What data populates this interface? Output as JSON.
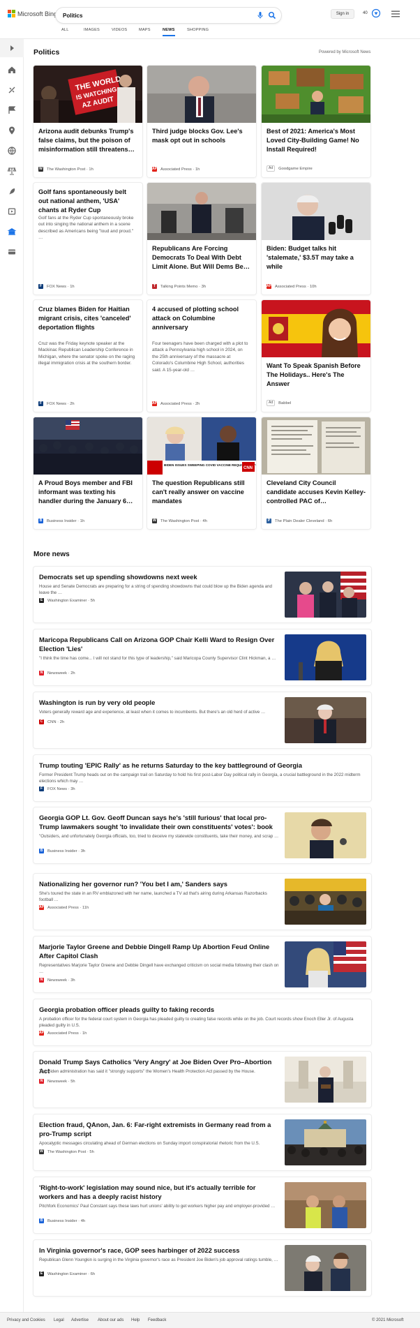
{
  "header": {
    "logo_text": "Microsoft Bing",
    "search_value": "Politics",
    "signin_label": "Sign in",
    "points": "40",
    "tabs": [
      "ALL",
      "IMAGES",
      "VIDEOS",
      "MAPS",
      "NEWS",
      "SHOPPING"
    ],
    "active_tab": "NEWS"
  },
  "rail": {
    "icons": [
      "expand-icon",
      "home-icon",
      "sports-icon",
      "flag-icon",
      "location-icon",
      "globe-icon",
      "scales-icon",
      "rocket-icon",
      "entertainment-icon",
      "bank-icon",
      "card-icon"
    ]
  },
  "section": {
    "title": "Politics",
    "powered": "Powered by Microsoft News"
  },
  "cards": [
    {
      "title": "Arizona audit debunks Trump's false claims, but the poison of misinformation still threatens…",
      "snippet": "",
      "source": "The Washington Post",
      "age": "1h",
      "fav": "#333",
      "fav_letter": "W",
      "ad": false
    },
    {
      "title": "Third judge blocks Gov. Lee's mask opt out in schools",
      "snippet": "",
      "source": "Associated Press",
      "age": "1h",
      "fav": "#e2231a",
      "fav_letter": "AP",
      "ad": false
    },
    {
      "title": "Best of 2021: America's Most Loved City-Building Game! No Install Required!",
      "snippet": "",
      "source": "Goodgame Empire",
      "age": "",
      "fav": "",
      "fav_letter": "",
      "ad": true,
      "ad_label": "Ad"
    },
    {
      "title": "Golf fans spontaneously belt out national anthem, 'USA' chants at Ryder Cup",
      "snippet": "Golf fans at the Ryder Cup spontaneously broke out into singing the national anthem in a scene described as Americans being \"loud and proud.\" …",
      "source": "FOX News",
      "age": "1h",
      "fav": "#0f3d7a",
      "fav_letter": "F",
      "ad": false
    },
    {
      "title": "Republicans Are Forcing Democrats To Deal With Debt Limit Alone. But Will Dems Be…",
      "snippet": "",
      "source": "Talking Points Memo",
      "age": "3h",
      "fav": "#c0282d",
      "fav_letter": "T",
      "ad": false
    },
    {
      "title": "Biden: Budget talks hit 'stalemate,' $3.5T may take a while",
      "snippet": "",
      "source": "Associated Press",
      "age": "10h",
      "fav": "#e2231a",
      "fav_letter": "AP",
      "ad": false
    },
    {
      "title": "Cruz blames Biden for Haitian migrant crisis, cites 'canceled' deportation flights",
      "snippet": "Cruz was the Friday keynote speaker at the Mackinac Republican Leadership Conference in Michigan, where the senator spoke on the raging illegal immigration crisis at the southern border.",
      "source": "FOX News",
      "age": "2h",
      "fav": "#0f3d7a",
      "fav_letter": "F",
      "ad": false
    },
    {
      "title": "4 accused of plotting school attack on Columbine anniversary",
      "snippet": "Four teenagers have been charged with a plot to attack a Pennsylvania high school in 2024, on the 25th anniversary of the massacre at Colorado's Columbine High School, authorities said. A 15-year-old …",
      "source": "Associated Press",
      "age": "2h",
      "fav": "#e2231a",
      "fav_letter": "AP",
      "ad": false
    },
    {
      "title": "Want To Speak Spanish Before The Holidays.. Here's The Answer",
      "snippet": "",
      "source": "Babbel",
      "age": "",
      "fav": "",
      "fav_letter": "",
      "ad": true,
      "ad_label": "Ad"
    },
    {
      "title": "A Proud Boys member and FBI informant was texting his handler during the January 6…",
      "snippet": "",
      "source": "Business Insider",
      "age": "1h",
      "fav": "#1a63d8",
      "fav_letter": "B",
      "ad": false
    },
    {
      "title": "The question Republicans still can't really answer on vaccine mandates",
      "snippet": "",
      "source": "The Washington Post",
      "age": "4h",
      "fav": "#333",
      "fav_letter": "W",
      "ad": false
    },
    {
      "title": "Cleveland City Council candidate accuses Kevin Kelley-controlled PAC of…",
      "snippet": "",
      "source": "The Plain Dealer Cleveland",
      "age": "6h",
      "fav": "#2b5f9e",
      "fav_letter": "P",
      "ad": false
    }
  ],
  "card_art": {
    "cnn_banner": "BIDEN ISSUES SWEEPING COVID VACCINE REQUIREMENTS FOR FEDERAL WORKERS AND CONTRACTORS, LARGE BUSINESSES",
    "cnn_logo": "CNN",
    "sign_text_1": "THE WORLD",
    "sign_text_2": "IS WATCHING",
    "sign_text_3": "AZ AUDIT"
  },
  "more": {
    "title": "More news",
    "rows": [
      {
        "title": "Democrats set up spending showdowns next week",
        "snippet": "House and Senate Democrats are preparing for a string of spending showdowns that could blow up the Biden agenda and leave the …",
        "source": "Washington Examiner",
        "age": "5h",
        "fav": "#222",
        "fav_letter": "E",
        "has_img": true
      },
      {
        "title": "Maricopa Republicans Call on Arizona GOP Chair Kelli Ward to Resign Over Election 'Lies'",
        "snippet": "\"I think the time has come... I will not stand for this type of leadership,\" said Maricopa County Supervisor Clint Hickman, a …",
        "source": "Newsweek",
        "age": "2h",
        "fav": "#e0202a",
        "fav_letter": "N",
        "has_img": true
      },
      {
        "title": "Washington is run by very old people",
        "snippet": "Voters generally reward age and experience, at least when it comes to incumbents. But there's an old herd of active …",
        "source": "CNN",
        "age": "2h",
        "fav": "#cc0000",
        "fav_letter": "C",
        "has_img": true
      },
      {
        "title": "Trump touting 'EPIC Rally' as he returns Saturday to the key battleground of Georgia",
        "snippet": "Former President Trump heads out on the campaign trail on Saturday to hold his first post-Labor Day political rally in Georgia, a crucial battleground in the 2022 midterm elections which may …",
        "source": "FOX News",
        "age": "3h",
        "fav": "#0f3d7a",
        "fav_letter": "F",
        "has_img": false
      },
      {
        "title": "Georgia GOP Lt. Gov. Geoff Duncan says he's 'still furious' that local pro-Trump lawmakers sought 'to invalidate their own constituents' votes': book",
        "snippet": "\"Outsiders, and unfortunately Georgia officials, too, tried to deceive my statewide constituents, take their money, and scrap …",
        "source": "Business Insider",
        "age": "3h",
        "fav": "#1a63d8",
        "fav_letter": "B",
        "has_img": true
      },
      {
        "title": "Nationalizing her governor run? 'You bet I am,' Sanders says",
        "snippet": "She's toured the state in an RV emblazoned with her name, launched a TV ad that's airing during Arkansas Razorbacks football …",
        "source": "Associated Press",
        "age": "11h",
        "fav": "#e2231a",
        "fav_letter": "AP",
        "has_img": true
      },
      {
        "title": "Marjorie Taylor Greene and Debbie Dingell Ramp Up Abortion Feud Online After Capitol Clash",
        "snippet": "Representatives Marjorie Taylor Greene and Debbie Dingell have exchanged criticism on social media following their clash on …",
        "source": "Newsweek",
        "age": "3h",
        "fav": "#e0202a",
        "fav_letter": "N",
        "has_img": true
      },
      {
        "title": "Georgia probation officer pleads guilty to faking records",
        "snippet": "A probation officer for the federal court system in Georgia has pleaded guilty to creating false records while on the job. Court records show Enoch Eller Jr. of Augusta pleaded guilty in U.S.",
        "source": "Associated Press",
        "age": "1h",
        "fav": "#e2231a",
        "fav_letter": "AP",
        "has_img": false
      },
      {
        "title": "Donald Trump Says Catholics 'Very Angry' at Joe Biden Over Pro–Abortion Act",
        "snippet": "The Biden administration has said it \"strongly supports\" the Women's Health Protection Act passed by the House.",
        "source": "Newsweek",
        "age": "5h",
        "fav": "#e0202a",
        "fav_letter": "N",
        "has_img": true
      },
      {
        "title": "Election fraud, QAnon, Jan. 6: Far-right extremists in Germany read from a pro-Trump script",
        "snippet": "Apocalyptic messages circulating ahead of German elections on Sunday import conspiratorial rhetoric from the U.S.",
        "source": "The Washington Post",
        "age": "5h",
        "fav": "#333",
        "fav_letter": "W",
        "has_img": true
      },
      {
        "title": "'Right-to-work' legislation may sound nice, but it's actually terrible for workers and has a deeply racist history",
        "snippet": "Pitchfork Economics' Paul Constant says these laws hurt unions' ability to get workers higher pay and employer-provided …",
        "source": "Business Insider",
        "age": "4h",
        "fav": "#1a63d8",
        "fav_letter": "B",
        "has_img": true
      },
      {
        "title": "In Virginia governor's race, GOP sees harbinger of 2022 success",
        "snippet": "Republican Glenn Youngkin is surging in the Virginia governor's race as President Joe Biden's job approval ratings tumble, …",
        "source": "Washington Examiner",
        "age": "6h",
        "fav": "#222",
        "fav_letter": "E",
        "has_img": true
      }
    ]
  },
  "footer": {
    "links": [
      "Privacy and Cookies",
      "Legal",
      "Advertise",
      "About our ads",
      "Help",
      "Feedback"
    ],
    "copyright": "© 2021 Microsoft"
  },
  "colors": {
    "accent": "#1a73e8",
    "ms_red": "#f25022",
    "ms_green": "#7fba00",
    "ms_blue": "#00a4ef",
    "ms_yellow": "#ffb900"
  }
}
